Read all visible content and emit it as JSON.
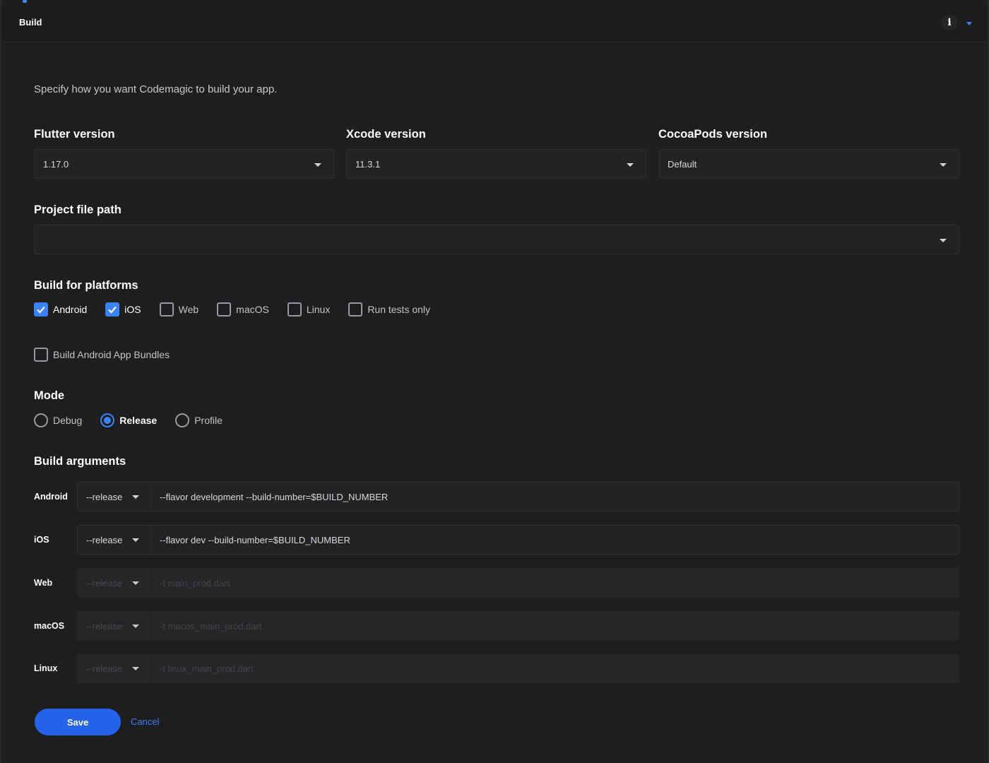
{
  "header": {
    "title": "Build",
    "info_icon": "info-icon",
    "collapse_icon": "chevron-down-icon",
    "accent_color": "#3b82f6"
  },
  "intro": "Specify how you want Codemagic to build your app.",
  "versions": {
    "flutter": {
      "label": "Flutter version",
      "value": "1.17.0"
    },
    "xcode": {
      "label": "Xcode version",
      "value": "11.3.1"
    },
    "cocoapods": {
      "label": "CocoaPods version",
      "value": "Default"
    }
  },
  "project_path": {
    "label": "Project file path",
    "value": ""
  },
  "platforms": {
    "label": "Build for platforms",
    "items": [
      {
        "label": "Android",
        "checked": true
      },
      {
        "label": "iOS",
        "checked": true
      },
      {
        "label": "Web",
        "checked": false
      },
      {
        "label": "macOS",
        "checked": false
      },
      {
        "label": "Linux",
        "checked": false
      },
      {
        "label": "Run tests only",
        "checked": false
      }
    ],
    "bundles": {
      "label": "Build Android App Bundles",
      "checked": false
    }
  },
  "mode": {
    "label": "Mode",
    "options": [
      "Debug",
      "Release",
      "Profile"
    ],
    "selected": "Release"
  },
  "build_arguments": {
    "label": "Build arguments",
    "rows": [
      {
        "platform": "Android",
        "mode": "--release",
        "args": "--flavor development --build-number=$BUILD_NUMBER",
        "enabled": true
      },
      {
        "platform": "iOS",
        "mode": "--release",
        "args": "--flavor dev --build-number=$BUILD_NUMBER",
        "enabled": true
      },
      {
        "platform": "Web",
        "mode": "--release",
        "args": "-t main_prod.dart",
        "enabled": false
      },
      {
        "platform": "macOS",
        "mode": "--release",
        "args": "-t macos_main_prod.dart",
        "enabled": false
      },
      {
        "platform": "Linux",
        "mode": "--release",
        "args": "-t linux_main_prod.dart",
        "enabled": false
      }
    ]
  },
  "actions": {
    "save": "Save",
    "cancel": "Cancel"
  }
}
